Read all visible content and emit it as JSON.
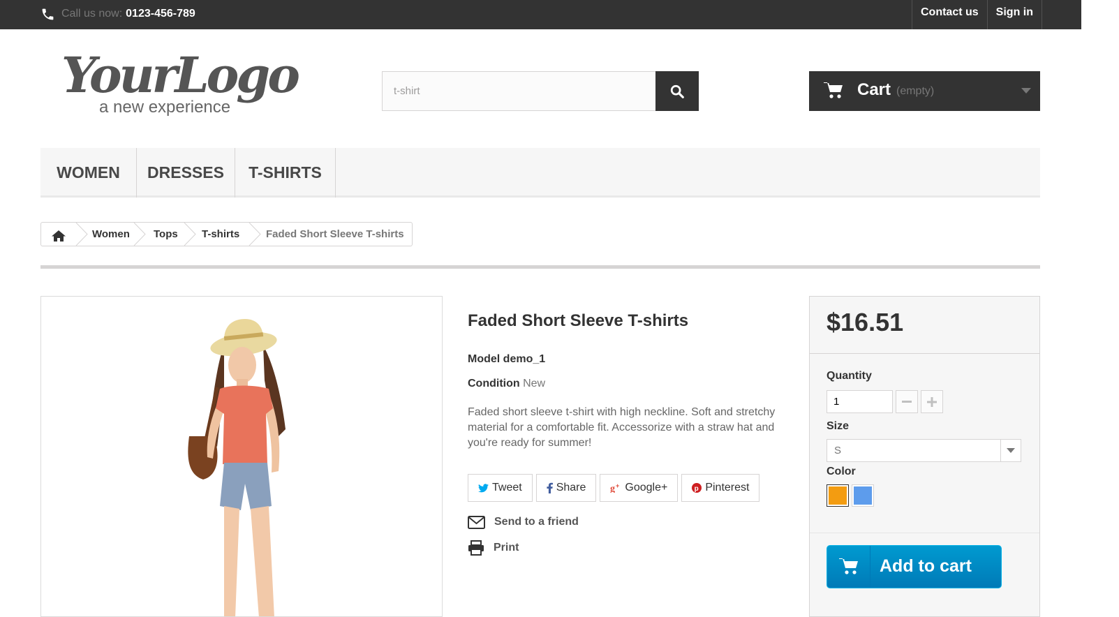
{
  "topbar": {
    "call_label": "Call us now:",
    "phone": "0123-456-789",
    "links": [
      "Contact us",
      "Sign in"
    ]
  },
  "logo": {
    "main": "YourLogo",
    "sub": "a new experience"
  },
  "search": {
    "value": "t-shirt",
    "icon": "search-icon"
  },
  "cart": {
    "title": "Cart",
    "status": "(empty)",
    "icon": "cart-icon"
  },
  "menu": {
    "items": [
      "WOMEN",
      "DRESSES",
      "T-SHIRTS"
    ]
  },
  "breadcrumb": {
    "items": [
      "Women",
      "Tops",
      "T-shirts"
    ],
    "current": "Faded Short Sleeve T-shirts"
  },
  "product": {
    "title": "Faded Short Sleeve T-shirts",
    "model_label": "Model",
    "model": "demo_1",
    "condition_label": "Condition",
    "condition": "New",
    "description": "Faded short sleeve t-shirt with high neckline. Soft and stretchy material for a comfortable fit. Accessorize with a straw hat and you're ready for summer!",
    "image_alt": "woman in straw hat, orange top and denim shorts"
  },
  "social": {
    "tweet": "Tweet",
    "share": "Share",
    "google": "Google+",
    "pinterest": "Pinterest"
  },
  "actions": {
    "send": "Send to a friend",
    "print": "Print"
  },
  "buy": {
    "price": "$16.51",
    "quantity_label": "Quantity",
    "quantity": "1",
    "size_label": "Size",
    "size": "S",
    "color_label": "Color",
    "colors": [
      "#f39c11",
      "#5d9cec"
    ],
    "add_to_cart": "Add to cart"
  },
  "theme": {
    "dark": "#333333",
    "accent": "#0088c8"
  }
}
